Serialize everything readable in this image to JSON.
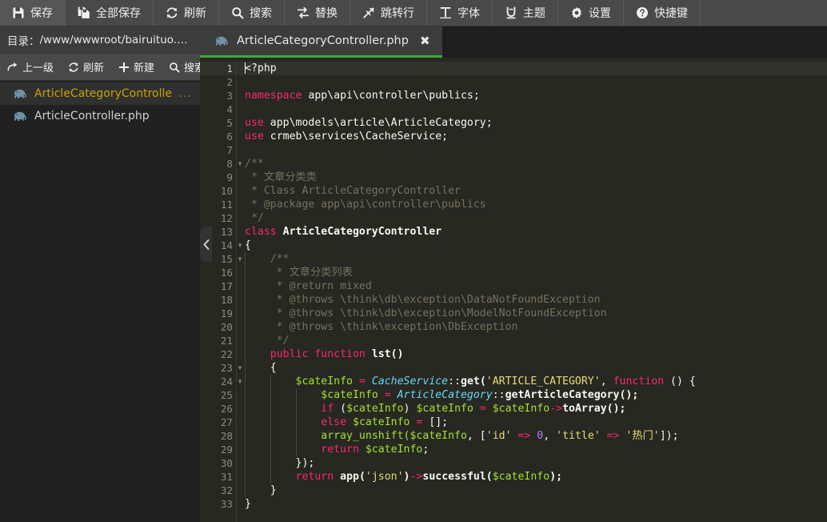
{
  "toolbar": {
    "buttons": [
      {
        "icon": "save-icon",
        "label": "保存"
      },
      {
        "icon": "save-all-icon",
        "label": "全部保存"
      },
      {
        "icon": "refresh-icon",
        "label": "刷新"
      },
      {
        "icon": "search-icon",
        "label": "搜索"
      },
      {
        "icon": "replace-icon",
        "label": "替换"
      },
      {
        "icon": "goto-line-icon",
        "label": "跳转行"
      },
      {
        "icon": "font-icon",
        "label": "字体"
      },
      {
        "icon": "theme-icon",
        "label": "主题"
      },
      {
        "icon": "settings-icon",
        "label": "设置"
      },
      {
        "icon": "shortcut-icon",
        "label": "快捷键"
      }
    ]
  },
  "sidebar": {
    "dir_label": "目录：",
    "dir_path": "/www/wwwroot/bairuituo.net/a...",
    "actions": [
      {
        "icon": "up-level-icon",
        "label": "上一级"
      },
      {
        "icon": "refresh-icon",
        "label": "刷新"
      },
      {
        "icon": "plus-icon",
        "label": "新建"
      },
      {
        "icon": "search-icon",
        "label": "搜索"
      }
    ],
    "files": [
      {
        "icon": "php-elephant-icon",
        "name": "ArticleCategoryControlle",
        "more": "...",
        "selected": true
      },
      {
        "icon": "php-elephant-icon",
        "name": "ArticleController.php",
        "more": "",
        "selected": false
      }
    ],
    "collapse_icon": "chevron-left-icon"
  },
  "editor": {
    "tabs": [
      {
        "icon": "php-elephant-icon",
        "label": "ArticleCategoryController.php",
        "close_icon": "close-icon",
        "active": true
      }
    ],
    "active_line": 1,
    "colors": {
      "background": "#272822",
      "keyword": "#f92672",
      "string": "#e6db74",
      "class": "#66d9ef",
      "function": "#a6e22e",
      "number": "#ae81ff",
      "comment": "#75715e",
      "text": "#f8f8f2",
      "tab_accent": "#3aab3a"
    },
    "lines": [
      {
        "n": 1,
        "fold": false,
        "indent": 0,
        "tokens": [
          {
            "c": "caret",
            "t": ""
          },
          {
            "c": "plain",
            "t": "<?php"
          }
        ]
      },
      {
        "n": 2,
        "fold": false,
        "indent": 0,
        "tokens": []
      },
      {
        "n": 3,
        "fold": false,
        "indent": 0,
        "tokens": [
          {
            "c": "key",
            "t": "namespace"
          },
          {
            "c": "plain",
            "t": " app\\api\\controller\\publics;"
          }
        ]
      },
      {
        "n": 4,
        "fold": false,
        "indent": 0,
        "tokens": []
      },
      {
        "n": 5,
        "fold": false,
        "indent": 0,
        "tokens": [
          {
            "c": "key",
            "t": "use"
          },
          {
            "c": "plain",
            "t": " app\\models\\article\\ArticleCategory;"
          }
        ]
      },
      {
        "n": 6,
        "fold": false,
        "indent": 0,
        "tokens": [
          {
            "c": "key",
            "t": "use"
          },
          {
            "c": "plain",
            "t": " crmeb\\services\\CacheService;"
          }
        ]
      },
      {
        "n": 7,
        "fold": false,
        "indent": 0,
        "tokens": []
      },
      {
        "n": 8,
        "fold": true,
        "indent": 0,
        "tokens": [
          {
            "c": "cmt",
            "t": "/**"
          }
        ]
      },
      {
        "n": 9,
        "fold": false,
        "indent": 0,
        "tokens": [
          {
            "c": "cmt",
            "t": " * 文章分类类"
          }
        ]
      },
      {
        "n": 10,
        "fold": false,
        "indent": 0,
        "tokens": [
          {
            "c": "cmt",
            "t": " * Class ArticleCategoryController"
          }
        ]
      },
      {
        "n": 11,
        "fold": false,
        "indent": 0,
        "tokens": [
          {
            "c": "cmt",
            "t": " * @package app\\api\\controller\\publics"
          }
        ]
      },
      {
        "n": 12,
        "fold": false,
        "indent": 0,
        "tokens": [
          {
            "c": "cmt",
            "t": " */"
          }
        ]
      },
      {
        "n": 13,
        "fold": false,
        "indent": 0,
        "tokens": [
          {
            "c": "key",
            "t": "class"
          },
          {
            "c": "plain",
            "t": " "
          },
          {
            "c": "plain-bold",
            "t": "ArticleCategoryController"
          }
        ]
      },
      {
        "n": 14,
        "fold": true,
        "indent": 0,
        "tokens": [
          {
            "c": "punct",
            "t": "{"
          }
        ]
      },
      {
        "n": 15,
        "fold": true,
        "indent": 1,
        "tokens": [
          {
            "c": "cmt",
            "t": "/**"
          }
        ]
      },
      {
        "n": 16,
        "fold": false,
        "indent": 1,
        "tokens": [
          {
            "c": "cmt",
            "t": " * 文章分类列表"
          }
        ]
      },
      {
        "n": 17,
        "fold": false,
        "indent": 1,
        "tokens": [
          {
            "c": "cmt",
            "t": " * @return mixed"
          }
        ]
      },
      {
        "n": 18,
        "fold": false,
        "indent": 1,
        "tokens": [
          {
            "c": "cmt",
            "t": " * @throws \\think\\db\\exception\\DataNotFoundException"
          }
        ]
      },
      {
        "n": 19,
        "fold": false,
        "indent": 1,
        "tokens": [
          {
            "c": "cmt",
            "t": " * @throws \\think\\db\\exception\\ModelNotFoundException"
          }
        ]
      },
      {
        "n": 20,
        "fold": false,
        "indent": 1,
        "tokens": [
          {
            "c": "cmt",
            "t": " * @throws \\think\\exception\\DbException"
          }
        ]
      },
      {
        "n": 21,
        "fold": false,
        "indent": 1,
        "tokens": [
          {
            "c": "cmt",
            "t": " */"
          }
        ]
      },
      {
        "n": 22,
        "fold": false,
        "indent": 1,
        "tokens": [
          {
            "c": "key",
            "t": "public function"
          },
          {
            "c": "plain",
            "t": " "
          },
          {
            "c": "plain-bold",
            "t": "lst()"
          }
        ]
      },
      {
        "n": 23,
        "fold": true,
        "indent": 1,
        "tokens": [
          {
            "c": "punct",
            "t": "{"
          }
        ]
      },
      {
        "n": 24,
        "fold": true,
        "indent": 2,
        "tokens": [
          {
            "c": "var",
            "t": "$cateInfo"
          },
          {
            "c": "op",
            "t": " = "
          },
          {
            "c": "cls",
            "t": "CacheService"
          },
          {
            "c": "punct",
            "t": "::"
          },
          {
            "c": "plain-bold",
            "t": "get("
          },
          {
            "c": "str",
            "t": "'ARTICLE_CATEGORY'"
          },
          {
            "c": "punct",
            "t": ", "
          },
          {
            "c": "key",
            "t": "function"
          },
          {
            "c": "punct",
            "t": " () {"
          }
        ]
      },
      {
        "n": 25,
        "fold": false,
        "indent": 3,
        "tokens": [
          {
            "c": "var",
            "t": "$cateInfo"
          },
          {
            "c": "op",
            "t": " = "
          },
          {
            "c": "cls",
            "t": "ArticleCategory"
          },
          {
            "c": "punct",
            "t": "::"
          },
          {
            "c": "plain-bold",
            "t": "getArticleCategory();"
          }
        ]
      },
      {
        "n": 26,
        "fold": false,
        "indent": 3,
        "tokens": [
          {
            "c": "key",
            "t": "if"
          },
          {
            "c": "punct",
            "t": " ("
          },
          {
            "c": "var",
            "t": "$cateInfo"
          },
          {
            "c": "punct",
            "t": ") "
          },
          {
            "c": "var",
            "t": "$cateInfo"
          },
          {
            "c": "op",
            "t": " = "
          },
          {
            "c": "var",
            "t": "$cateInfo"
          },
          {
            "c": "op",
            "t": "->"
          },
          {
            "c": "plain-bold",
            "t": "toArray();"
          }
        ]
      },
      {
        "n": 27,
        "fold": false,
        "indent": 3,
        "tokens": [
          {
            "c": "key",
            "t": "else"
          },
          {
            "c": "punct",
            "t": " "
          },
          {
            "c": "var",
            "t": "$cateInfo"
          },
          {
            "c": "op",
            "t": " = "
          },
          {
            "c": "punct",
            "t": "[];"
          }
        ]
      },
      {
        "n": 28,
        "fold": false,
        "indent": 3,
        "tokens": [
          {
            "c": "fn",
            "t": "array_unshift("
          },
          {
            "c": "var",
            "t": "$cateInfo"
          },
          {
            "c": "punct",
            "t": ", ["
          },
          {
            "c": "str",
            "t": "'id'"
          },
          {
            "c": "op",
            "t": " => "
          },
          {
            "c": "num",
            "t": "0"
          },
          {
            "c": "punct",
            "t": ", "
          },
          {
            "c": "str",
            "t": "'title'"
          },
          {
            "c": "op",
            "t": " => "
          },
          {
            "c": "str",
            "t": "'热门'"
          },
          {
            "c": "punct",
            "t": "]);"
          }
        ]
      },
      {
        "n": 29,
        "fold": false,
        "indent": 3,
        "tokens": [
          {
            "c": "key2",
            "t": "return"
          },
          {
            "c": "punct",
            "t": " "
          },
          {
            "c": "var",
            "t": "$cateInfo"
          },
          {
            "c": "punct",
            "t": ";"
          }
        ]
      },
      {
        "n": 30,
        "fold": false,
        "indent": 2,
        "tokens": [
          {
            "c": "punct",
            "t": "});"
          }
        ]
      },
      {
        "n": 31,
        "fold": false,
        "indent": 2,
        "tokens": [
          {
            "c": "key2",
            "t": "return"
          },
          {
            "c": "punct",
            "t": " "
          },
          {
            "c": "plain-bold",
            "t": "app("
          },
          {
            "c": "str",
            "t": "'json'"
          },
          {
            "c": "plain-bold",
            "t": ")"
          },
          {
            "c": "op",
            "t": "->"
          },
          {
            "c": "plain-bold",
            "t": "successful("
          },
          {
            "c": "var",
            "t": "$cateInfo"
          },
          {
            "c": "plain-bold",
            "t": ");"
          }
        ]
      },
      {
        "n": 32,
        "fold": false,
        "indent": 1,
        "tokens": [
          {
            "c": "punct",
            "t": "}"
          }
        ]
      },
      {
        "n": 33,
        "fold": false,
        "indent": 0,
        "tokens": [
          {
            "c": "punct",
            "t": "}"
          }
        ]
      }
    ]
  }
}
